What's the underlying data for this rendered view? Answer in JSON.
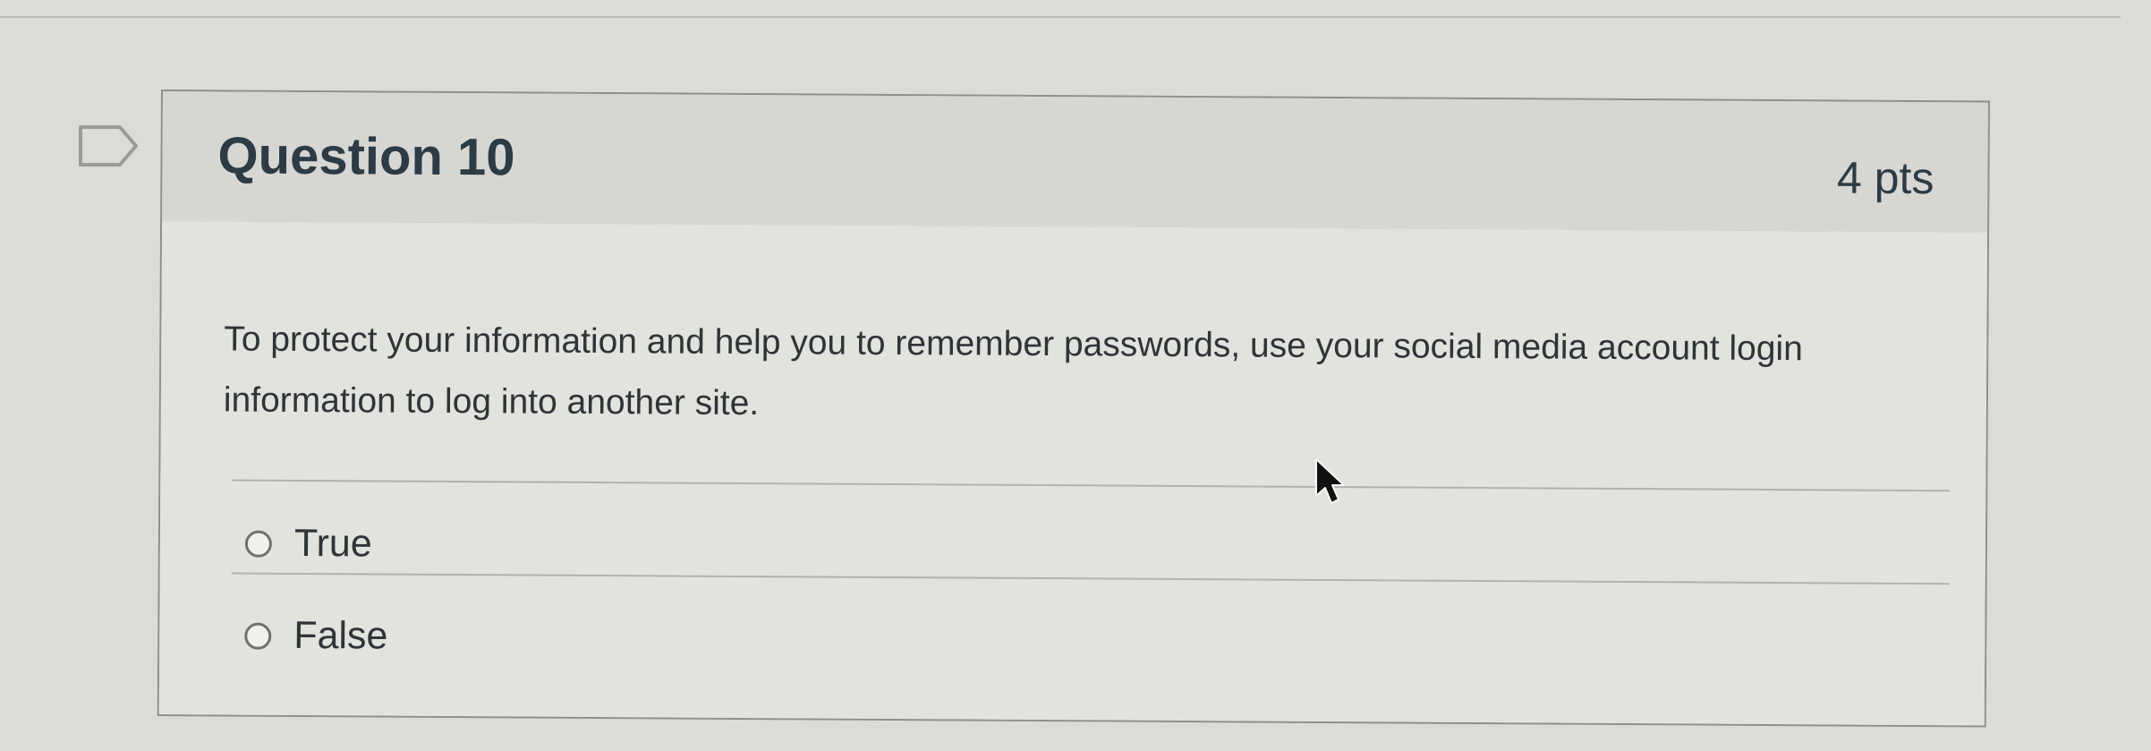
{
  "quiz": {
    "question": {
      "title": "Question 10",
      "points": "4 pts",
      "text": "To protect your information and help you to remember passwords, use your social media account login information to log into another site.",
      "answers": [
        {
          "label": "True",
          "selected": false
        },
        {
          "label": "False",
          "selected": false
        }
      ]
    }
  },
  "icons": {
    "flag": "flag-icon",
    "cursor": "mouse-pointer-icon"
  },
  "colors": {
    "page_background": "#dcdbd6",
    "header_background": "#d7d6d2",
    "body_background": "#e2e2de",
    "text": "#2d3b45"
  }
}
